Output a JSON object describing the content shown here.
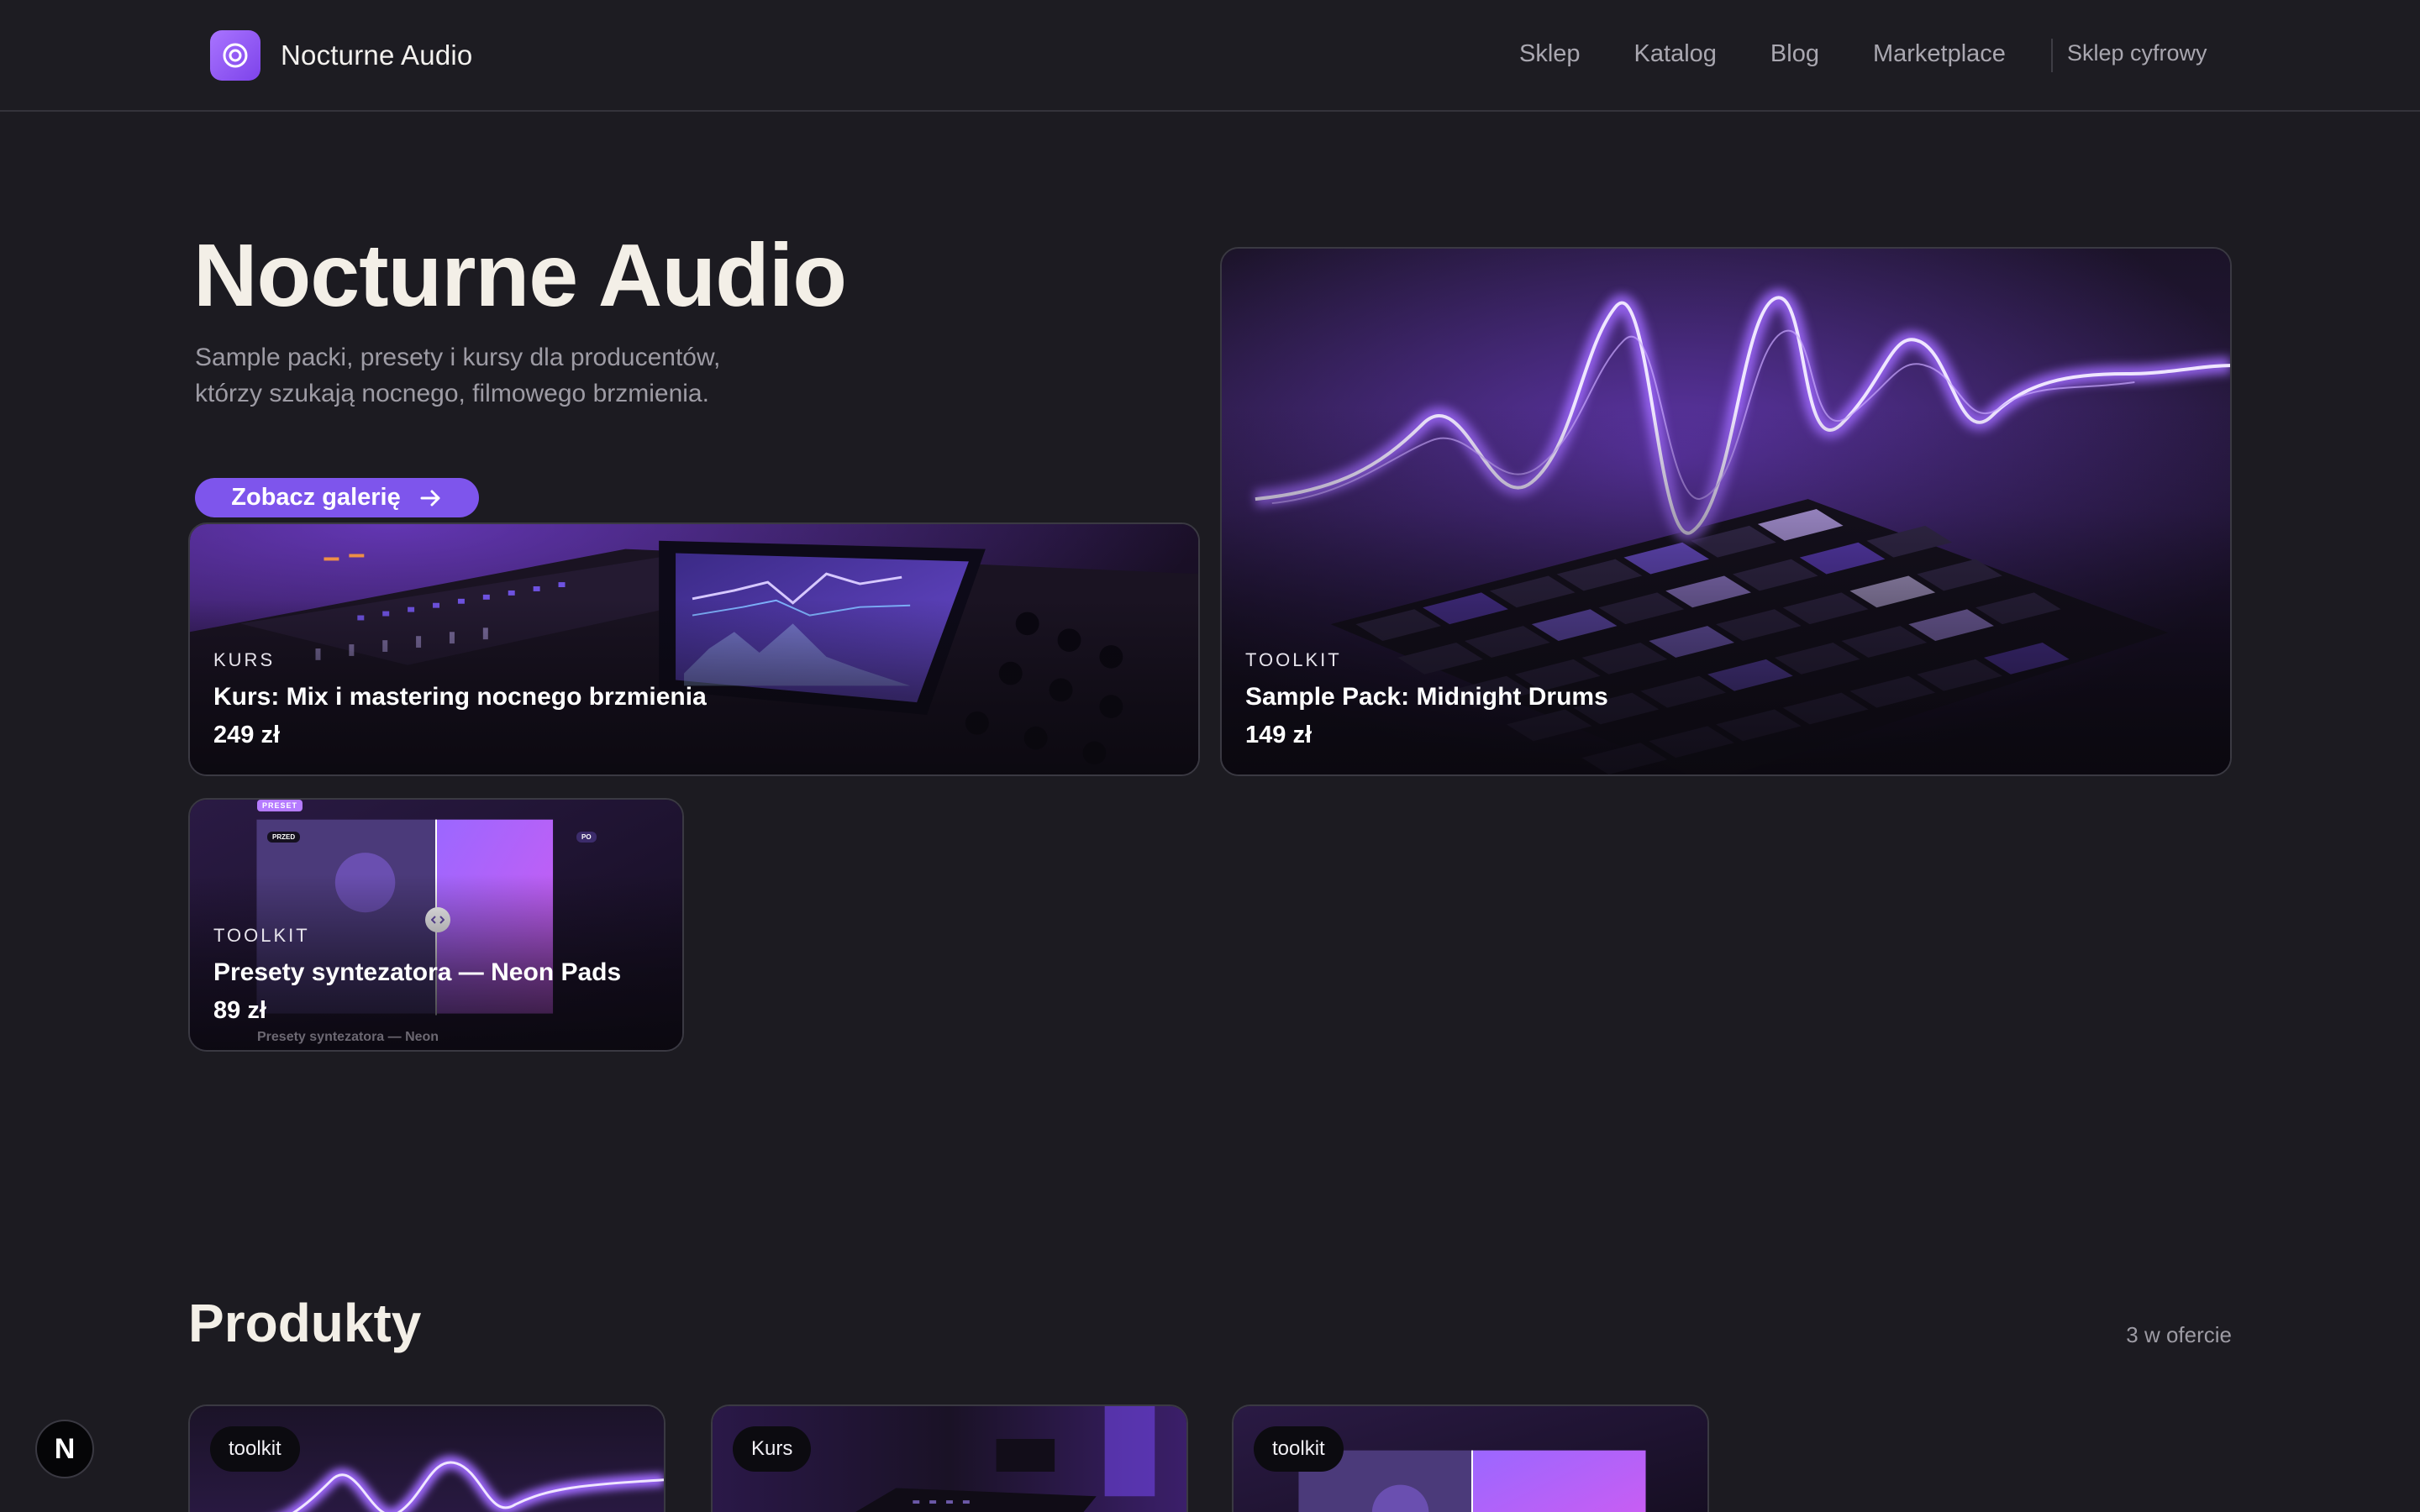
{
  "nav": {
    "brand": "Nocturne Audio",
    "links": [
      "Sklep",
      "Katalog",
      "Blog",
      "Marketplace"
    ],
    "shop_label": "Sklep cyfrowy"
  },
  "hero": {
    "title": "Nocturne Audio",
    "subtitle": "Sample packi, presety i kursy dla producentów, którzy szukają nocnego, filmowego brzmienia.",
    "cta": "Zobacz galerię"
  },
  "featured": [
    {
      "kicker": "KURS",
      "title": "Kurs: Mix i mastering nocnego brzmienia",
      "price": "249 zł"
    },
    {
      "kicker": "TOOLKIT",
      "title": "Sample Pack: Midnight Drums",
      "price": "149 zł"
    },
    {
      "kicker": "TOOLKIT",
      "title": "Presety syntezatora — Neon Pads",
      "price": "89 zł"
    }
  ],
  "preset_mock": {
    "tag": "PRESET",
    "before": "PRZED",
    "after": "PO",
    "caption": "Presety syntezatora — Neon"
  },
  "products": {
    "title": "Produkty",
    "count": "3 w ofercie",
    "items": [
      {
        "tag": "toolkit"
      },
      {
        "tag": "Kurs"
      },
      {
        "tag": "toolkit"
      }
    ]
  },
  "badge": "N",
  "colors": {
    "accent": "#7e55ec",
    "background": "#1c1b21",
    "glow": "#9a5cff"
  }
}
